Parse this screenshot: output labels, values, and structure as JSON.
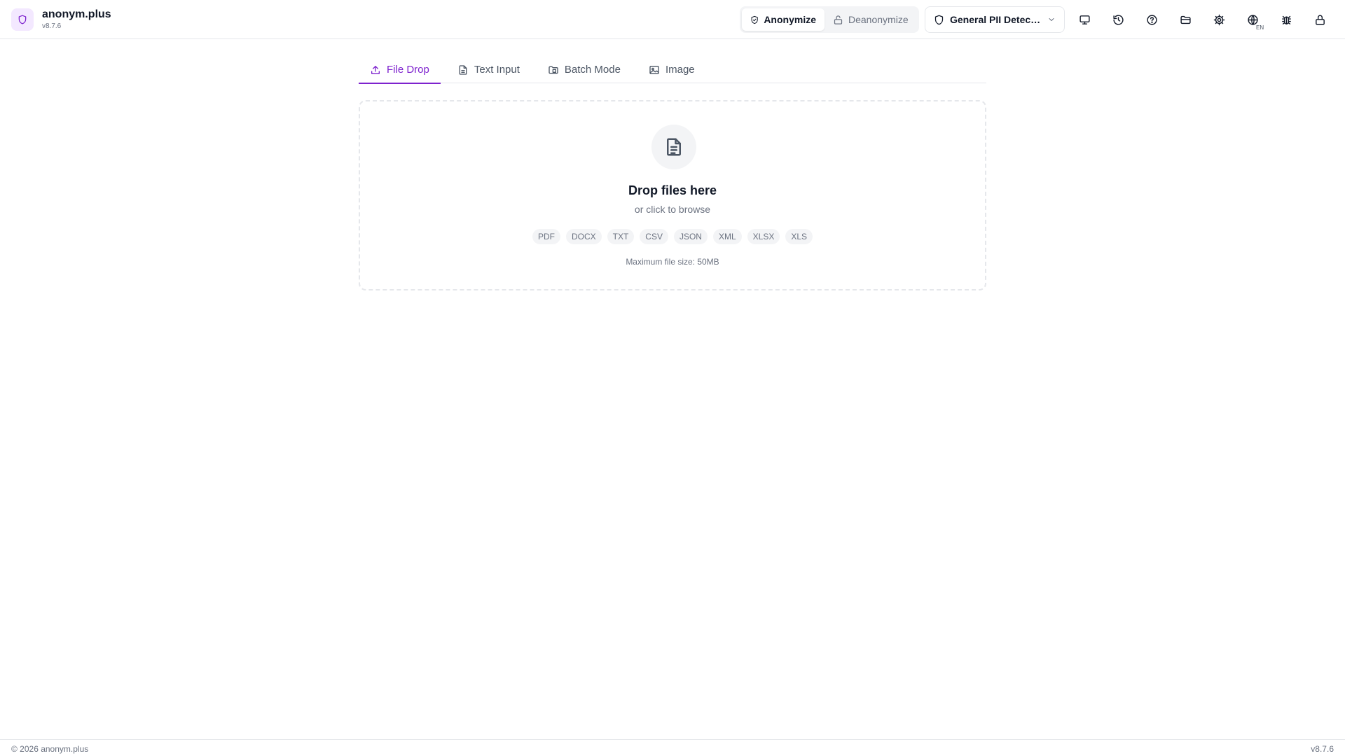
{
  "brand": {
    "name": "anonym.plus",
    "version": "v8.7.6",
    "logo_icon": "shield-icon"
  },
  "mode_toggle": {
    "anonymize_label": "Anonymize",
    "deanonymize_label": "Deanonymize",
    "active": "anonymize"
  },
  "profile": {
    "selected_label": "General PII Detecti..."
  },
  "toolbar": {
    "icons": [
      "monitor-icon",
      "history-icon",
      "help-icon",
      "folder-icon",
      "settings-icon",
      "globe-icon",
      "bug-icon",
      "lock-icon"
    ],
    "language_badge": "EN"
  },
  "tabs": [
    {
      "label": "File Drop",
      "icon": "upload-icon",
      "active": true
    },
    {
      "label": "Text Input",
      "icon": "document-icon",
      "active": false
    },
    {
      "label": "Batch Mode",
      "icon": "folder-batch-icon",
      "active": false
    },
    {
      "label": "Image",
      "icon": "image-icon",
      "active": false
    }
  ],
  "dropzone": {
    "title": "Drop files here",
    "subtitle": "or click to browse",
    "formats": [
      "PDF",
      "DOCX",
      "TXT",
      "CSV",
      "JSON",
      "XML",
      "XLSX",
      "XLS"
    ],
    "max_size_text": "Maximum file size: 50MB"
  },
  "footer": {
    "copyright": "© 2026 anonym.plus",
    "version": "v8.7.6"
  },
  "colors": {
    "accent": "#7e22ce",
    "accent_light": "#f3e8ff",
    "border": "#e5e7eb",
    "muted_text": "#6b7280"
  }
}
